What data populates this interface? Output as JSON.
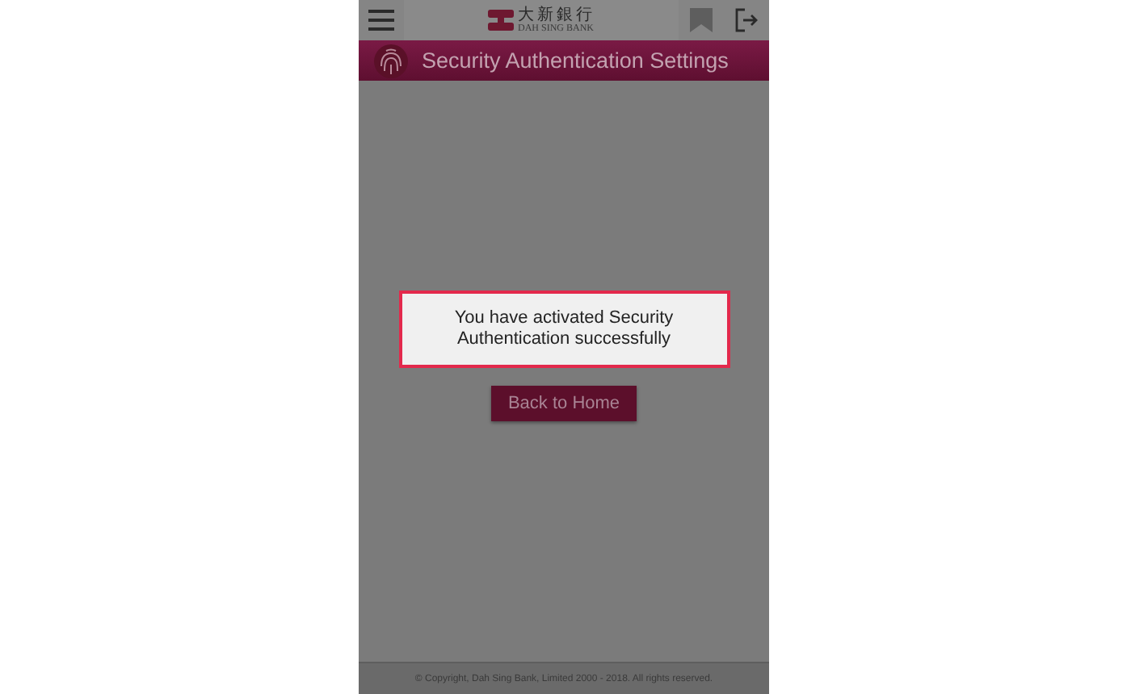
{
  "header": {
    "logo_chinese": "大新銀行",
    "logo_english": "DAH SING BANK"
  },
  "title_bar": {
    "title": "Security Authentication Settings"
  },
  "dialog": {
    "message": "You have activated Security Authentication successfully",
    "button": "Back to Home"
  },
  "footer": {
    "copyright": "© Copyright, Dah Sing Bank, Limited 2000 - 2018. All rights reserved."
  }
}
